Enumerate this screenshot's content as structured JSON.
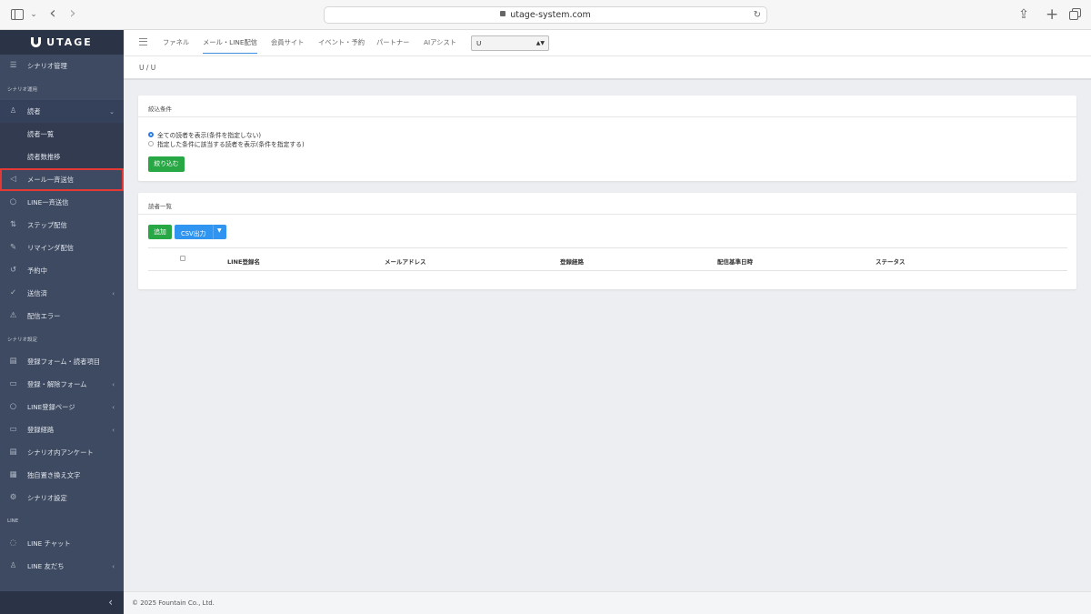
{
  "browser": {
    "url": "utage-system.com"
  },
  "sidebar": {
    "brand": "UTAGE",
    "top_item": "シナリオ管理",
    "section_ops": "シナリオ運用",
    "readers": "読者",
    "readers_list": "読者一覧",
    "readers_trend": "読者数推移",
    "mail_broadcast": "メール一斉送信",
    "line_broadcast": "LINE一斉送信",
    "step": "ステップ配信",
    "reminder": "リマインダ配信",
    "scheduled": "予約中",
    "sent": "送信済",
    "errors": "配信エラー",
    "section_settings": "シナリオ設定",
    "reg_form_fields": "登録フォーム・読者項目",
    "reg_unsub_form": "登録・解除フォーム",
    "line_reg_page": "LINE登録ページ",
    "reg_route": "登録経路",
    "survey": "シナリオ内アンケート",
    "replace_text": "独自置き換え文字",
    "scenario_settings": "シナリオ設定",
    "section_line": "LINE",
    "line_chat": "LINE チャット",
    "line_friends": "LINE 友だち"
  },
  "topnav": {
    "funnel": "ファネル",
    "mail_line": "メール・LINE配信",
    "member_site": "会員サイト",
    "event": "イベント・予約",
    "partner": "パートナー",
    "ai": "AIアシスト",
    "select_value": "U"
  },
  "breadcrumb": "U / U",
  "filter": {
    "title": "絞込条件",
    "option_all": "全ての読者を表示(条件を指定しない)",
    "option_cond": "指定した条件に該当する読者を表示(条件を指定する)",
    "apply": "絞り込む"
  },
  "list": {
    "title": "読者一覧",
    "add": "追加",
    "csv": "CSV出力",
    "columns": {
      "line_name": "LINE登録名",
      "email": "メールアドレス",
      "route": "登録経路",
      "base_date": "配信基準日時",
      "status": "ステータス"
    }
  },
  "footer": "© 2025 Fountain Co., Ltd.",
  "colors": {
    "sidebar_bg": "#3e4a61",
    "primary_green": "#28a745",
    "primary_blue": "#2f95f0",
    "highlight_red": "#e53935"
  }
}
